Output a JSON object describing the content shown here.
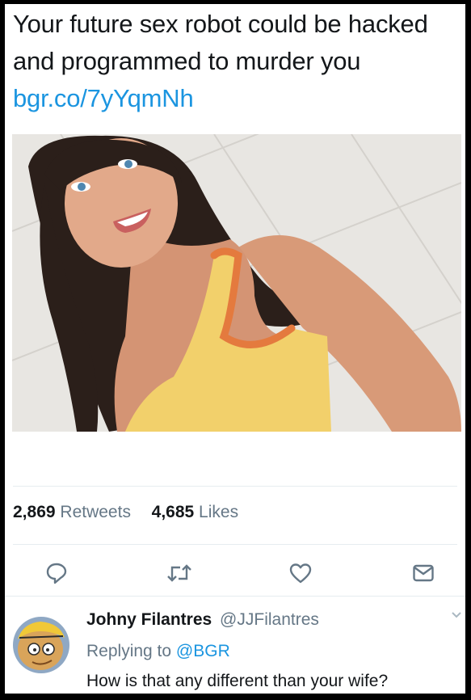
{
  "tweet": {
    "text": "Your future sex robot could be hacked and programmed to murder you",
    "link": "bgr.co/7yYqmNh"
  },
  "stats": {
    "retweets_count": "2,869",
    "retweets_label": "Retweets",
    "likes_count": "4,685",
    "likes_label": "Likes"
  },
  "actions": [
    "reply-icon",
    "retweet-icon",
    "heart-icon",
    "message-icon"
  ],
  "reply": {
    "name": "Johny Filantres",
    "handle": "@JJFilantres",
    "replying_prefix": "Replying to",
    "replying_to": "@BGR",
    "text": "How is that any different than your wife?"
  },
  "colors": {
    "link": "#1b95e0",
    "secondary_text": "#657786",
    "primary_text": "#14171a"
  }
}
